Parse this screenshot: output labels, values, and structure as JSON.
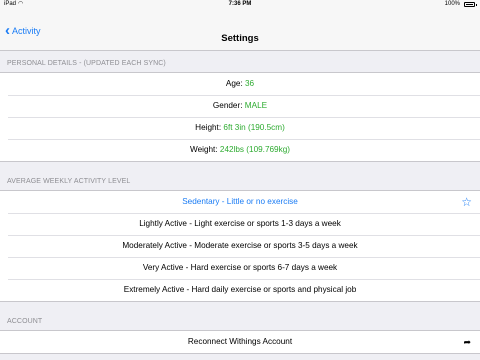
{
  "status_bar": {
    "carrier": "iPad",
    "wifi_icon": "wifi-icon",
    "time": "7:36 PM",
    "battery_percent": "100%",
    "battery_icon": "battery-icon"
  },
  "nav": {
    "back_label": "Activity",
    "back_icon": "chevron-left-icon",
    "title": "Settings",
    "accent_color": "#1a7cf5"
  },
  "personal": {
    "header": "PERSONAL DETAILS - (UPDATED EACH SYNC)",
    "rows": [
      {
        "label": "Age:",
        "value": "36"
      },
      {
        "label": "Gender:",
        "value": "MALE"
      },
      {
        "label": "Height:",
        "value": "6ft 3in (190.5cm)"
      },
      {
        "label": "Weight:",
        "value": "242lbs (109.769kg)"
      }
    ],
    "value_color": "#2dab30"
  },
  "activity": {
    "header": "AVERAGE WEEKLY ACTIVITY LEVEL",
    "options": [
      "Sedentary - Little or no exercise",
      "Lightly Active - Light exercise or sports 1-3 days a week",
      "Moderately Active - Moderate exercise or sports 3-5 days a week",
      "Very Active - Hard exercise or sports 6-7 days a week",
      "Extremely Active - Hard daily exercise or sports and physical job"
    ],
    "selected_index": 0,
    "selected_icon": "star-icon"
  },
  "account": {
    "header": "ACCOUNT",
    "reconnect_label": "Reconnect Withings Account",
    "reconnect_icon": "share-icon"
  }
}
